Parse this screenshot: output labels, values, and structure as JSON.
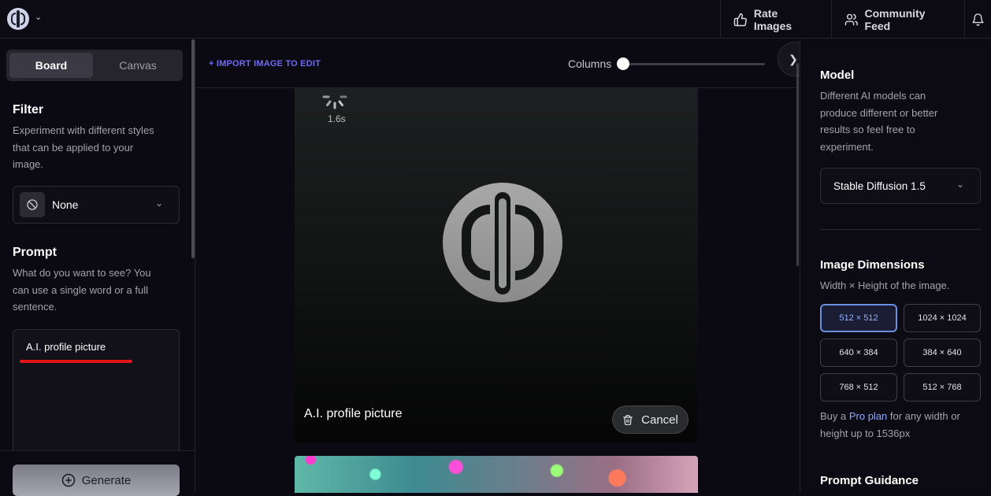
{
  "header": {
    "rate_images": "Rate Images",
    "community_feed": "Community Feed"
  },
  "left": {
    "tabs": [
      "Board",
      "Canvas"
    ],
    "filter": {
      "title": "Filter",
      "desc_lines": [
        "Experiment with different styles",
        "that can be applied to your",
        "image."
      ],
      "selected": "None"
    },
    "prompt": {
      "title": "Prompt",
      "desc_lines": [
        "What do you want to see? You",
        "can use a single word or a full",
        "sentence."
      ],
      "value": "A.I. profile picture"
    },
    "generate_label": "Generate"
  },
  "center": {
    "import_label": "+ IMPORT IMAGE TO EDIT",
    "columns_label": "Columns",
    "columns_value": 0,
    "timer": "1.6s",
    "card_title": "A.I. profile picture",
    "cancel_label": "Cancel"
  },
  "right": {
    "model": {
      "title": "Model",
      "desc_lines": [
        "Different AI models can",
        "produce different or better",
        "results so feel free to",
        "experiment."
      ],
      "selected": "Stable Diffusion 1.5"
    },
    "dimensions": {
      "title": "Image Dimensions",
      "desc": "Width × Height of the image.",
      "options": [
        "512 × 512",
        "1024 × 1024",
        "640 × 384",
        "384 × 640",
        "768 × 512",
        "512 × 768"
      ],
      "selected": "512 × 512",
      "note_prefix": "Buy a ",
      "note_link": "Pro plan",
      "note_suffix_1": " for any width or",
      "note_suffix_2": "height up to 1536px"
    },
    "guidance_title": "Prompt Guidance"
  },
  "colors": {
    "accent": "#6e6bf2",
    "selected_border": "#6c8fe0",
    "highlight_red": "#e01616"
  }
}
